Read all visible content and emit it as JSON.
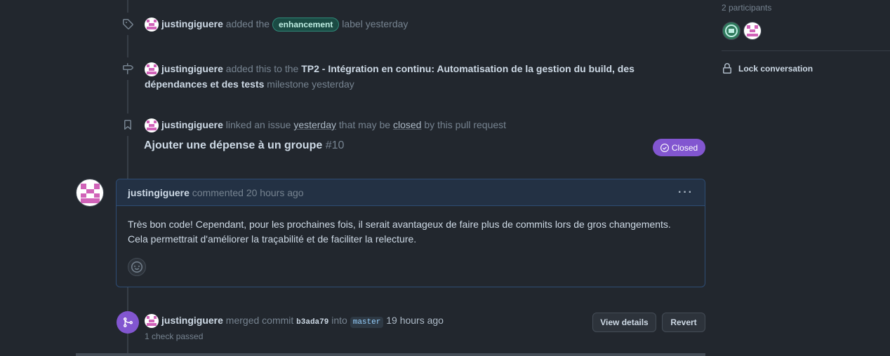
{
  "events": {
    "label": {
      "user": "justingiguere",
      "action": "added the",
      "label_name": "enhancement",
      "suffix": "label yesterday"
    },
    "milestone": {
      "user": "justingiguere",
      "action": "added this to the",
      "milestone_name": "TP2 - Intégration en continu: Automatisation de la gestion du build, des dépendances et des tests",
      "suffix": "milestone yesterday"
    },
    "linked": {
      "user": "justingiguere",
      "text1": "linked an issue",
      "when": "yesterday",
      "text2": "that may be",
      "closed_word": "closed",
      "text3": "by this pull request",
      "issue_title": "Ajouter une dépense à un groupe",
      "issue_number": "#10",
      "state_label": "Closed"
    },
    "comment": {
      "user": "justingiguere",
      "action": "commented",
      "when": "20 hours ago",
      "menu": "···",
      "body": "Très bon code! Cependant, pour les prochaines fois, il serait avantageux de faire plus de commits lors de gros changements. Cela permettrait d'améliorer la traçabilité et de faciliter la relecture."
    },
    "merge": {
      "user": "justingiguere",
      "action": "merged commit",
      "commit": "b3ada79",
      "into": "into",
      "branch": "master",
      "when": "19 hours ago",
      "checks": "1 check passed",
      "view_details": "View details",
      "revert": "Revert"
    }
  },
  "sidebar": {
    "participants": "2 participants",
    "lock": "Lock conversation"
  },
  "colors": {
    "background": "#22272e",
    "merged": "#8256d0",
    "closed": "#8256d0",
    "label": "#1b4b44",
    "avatar_pink": "#d062b8"
  },
  "icons": {
    "label_event": "tag-icon",
    "milestone_event": "milestone-icon",
    "linked_event": "bookmark-icon",
    "merge_event": "git-merge-icon",
    "closed_state": "check-circle-icon",
    "reaction": "smiley-icon",
    "lock": "lock-icon"
  }
}
